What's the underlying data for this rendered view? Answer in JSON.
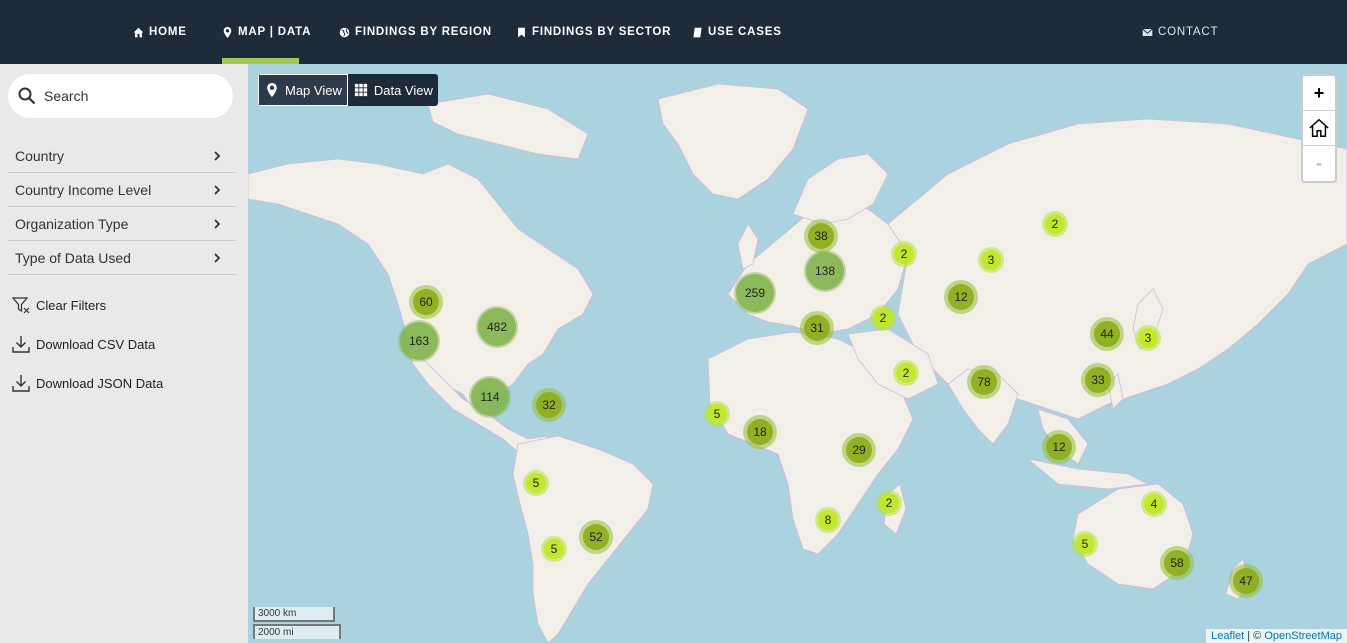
{
  "nav": {
    "items": [
      {
        "label": "HOME",
        "icon": "home-icon"
      },
      {
        "label": "MAP | DATA",
        "icon": "map-pin-icon"
      },
      {
        "label": "FINDINGS BY REGION",
        "icon": "globe-icon"
      },
      {
        "label": "FINDINGS BY SECTOR",
        "icon": "bookmark-icon"
      },
      {
        "label": "USE CASES",
        "icon": "book-icon"
      }
    ],
    "contact": "CONTACT",
    "active_index": 1
  },
  "sidebar": {
    "search_placeholder": "Search",
    "filters": [
      "Country",
      "Country Income Level",
      "Organization Type",
      "Type of Data Used"
    ],
    "actions": {
      "clear": "Clear Filters",
      "csv": "Download CSV Data",
      "json": "Download JSON Data"
    }
  },
  "map": {
    "view_toggle": {
      "map": "Map View",
      "data": "Data View",
      "active": "map"
    },
    "zoom": {
      "in": "+",
      "out": "-"
    },
    "scale": {
      "km": "3000 km",
      "mi": "2000 mi"
    },
    "attribution": {
      "leaflet": "Leaflet",
      "sep": " | © ",
      "osm": "OpenStreetMap"
    },
    "clusters": [
      {
        "count": "60",
        "size": "medium"
      },
      {
        "count": "482",
        "size": "large"
      },
      {
        "count": "163",
        "size": "large"
      },
      {
        "count": "114",
        "size": "large"
      },
      {
        "count": "32",
        "size": "medium"
      },
      {
        "count": "5",
        "size": "small"
      },
      {
        "count": "5",
        "size": "small"
      },
      {
        "count": "52",
        "size": "medium"
      },
      {
        "count": "38",
        "size": "medium"
      },
      {
        "count": "138",
        "size": "large"
      },
      {
        "count": "259",
        "size": "large"
      },
      {
        "count": "31",
        "size": "medium"
      },
      {
        "count": "2",
        "size": "small"
      },
      {
        "count": "3",
        "size": "small"
      },
      {
        "count": "2",
        "size": "small"
      },
      {
        "count": "12",
        "size": "medium"
      },
      {
        "count": "2",
        "size": "small"
      },
      {
        "count": "2",
        "size": "small"
      },
      {
        "count": "44",
        "size": "medium"
      },
      {
        "count": "3",
        "size": "small"
      },
      {
        "count": "78",
        "size": "medium"
      },
      {
        "count": "33",
        "size": "medium"
      },
      {
        "count": "5",
        "size": "small"
      },
      {
        "count": "18",
        "size": "medium"
      },
      {
        "count": "29",
        "size": "medium"
      },
      {
        "count": "2",
        "size": "small"
      },
      {
        "count": "8",
        "size": "small"
      },
      {
        "count": "12",
        "size": "medium"
      },
      {
        "count": "4",
        "size": "small"
      },
      {
        "count": "5",
        "size": "small"
      },
      {
        "count": "58",
        "size": "medium"
      },
      {
        "count": "47",
        "size": "medium"
      }
    ]
  }
}
